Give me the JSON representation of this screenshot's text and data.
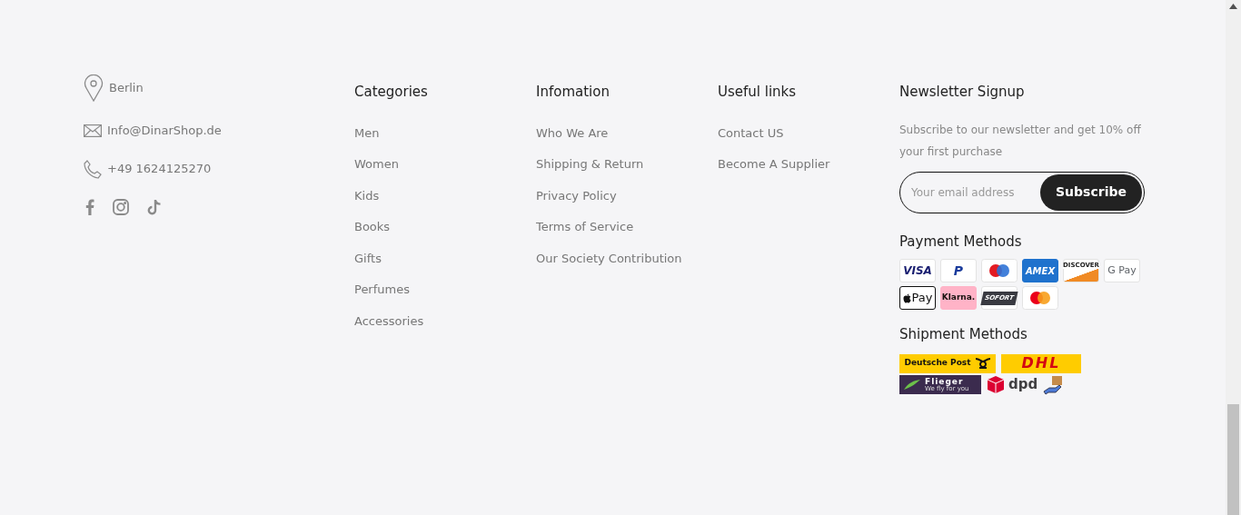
{
  "contact": [
    {
      "kind": "location",
      "text": "Berlin"
    },
    {
      "kind": "email",
      "text": "Info@DinarShop.de"
    },
    {
      "kind": "phone",
      "text": "+49 1624125270"
    }
  ],
  "social": [
    {
      "kind": "facebook"
    },
    {
      "kind": "instagram"
    },
    {
      "kind": "tiktok"
    }
  ],
  "columns": [
    {
      "title": "Categories",
      "links": [
        "Men",
        "Women",
        "Kids",
        "Books",
        "Gifts",
        "Perfumes",
        "Accessories"
      ]
    },
    {
      "title": "Infomation",
      "links": [
        "Who We Are",
        "Shipping & Return",
        "Privacy Policy",
        "Terms of Service",
        "Our Society Contribution"
      ]
    },
    {
      "title": "Useful links",
      "links": [
        "Contact US",
        "Become A Supplier"
      ]
    }
  ],
  "newsletter": {
    "title": "Newsletter Signup",
    "text": "Subscribe to our newsletter and get 10% off your first purchase",
    "placeholder": "Your email address",
    "button": "Subscribe"
  },
  "payment": {
    "title": "Payment Methods",
    "methods": [
      {
        "kind": "visa",
        "label": "VISA"
      },
      {
        "kind": "paypal",
        "label": "P"
      },
      {
        "kind": "maestro"
      },
      {
        "kind": "amex",
        "label": "AMEX"
      },
      {
        "kind": "discover",
        "label": "DISCOVER"
      },
      {
        "kind": "gpay",
        "label": "G Pay"
      },
      {
        "kind": "applepay",
        "label": "Pay"
      },
      {
        "kind": "klarna",
        "label": "Klarna."
      },
      {
        "kind": "sofort",
        "label": "SOFORT"
      },
      {
        "kind": "mastercard"
      }
    ]
  },
  "shipment": {
    "title": "Shipment Methods",
    "methods": [
      {
        "kind": "deutschepost",
        "label": "Deutsche Post"
      },
      {
        "kind": "dhl",
        "label": "DHL"
      },
      {
        "kind": "flieger",
        "label": "Flieger",
        "tagline": "We fly for you"
      },
      {
        "kind": "dpd",
        "label": "dpd"
      },
      {
        "kind": "hand"
      }
    ]
  }
}
